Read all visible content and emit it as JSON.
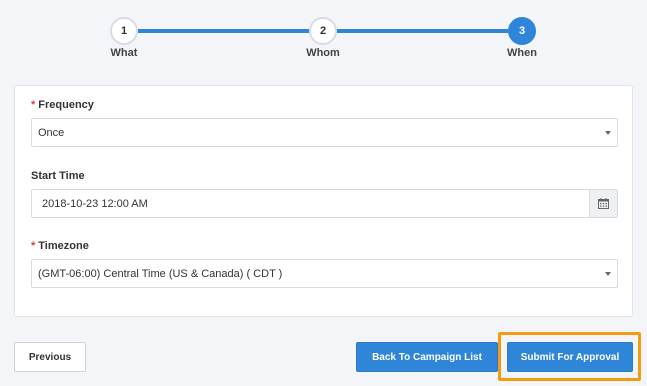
{
  "stepper": {
    "steps": [
      {
        "number": "1",
        "label": "What"
      },
      {
        "number": "2",
        "label": "Whom"
      },
      {
        "number": "3",
        "label": "When"
      }
    ]
  },
  "form": {
    "frequency": {
      "required_mark": "*",
      "label": "Frequency",
      "value": "Once"
    },
    "start_time": {
      "label": "Start Time",
      "value": "2018-10-23 12:00 AM"
    },
    "timezone": {
      "required_mark": "*",
      "label": "Timezone",
      "value": "(GMT-06:00) Central Time (US & Canada) ( CDT )"
    }
  },
  "actions": {
    "previous_label": "Previous",
    "back_label": "Back To Campaign List",
    "submit_label": "Submit For Approval"
  },
  "colors": {
    "primary": "#2f86d8",
    "highlight": "#f39c12",
    "required": "#e03b3b"
  },
  "icons": {
    "date_picker": "calendar-icon",
    "dropdown": "caret-down-icon"
  }
}
